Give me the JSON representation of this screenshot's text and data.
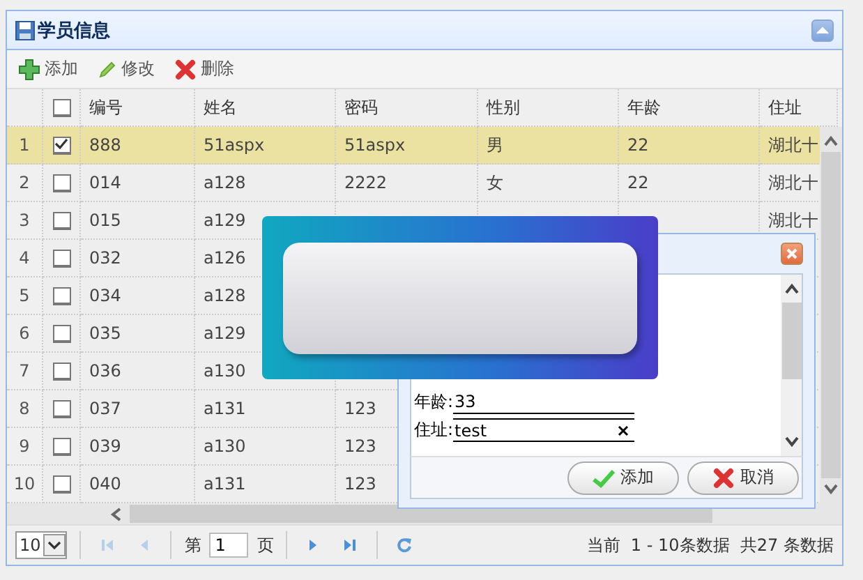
{
  "panel": {
    "title": "学员信息"
  },
  "toolbar": [
    {
      "kind": "add",
      "label": "添加"
    },
    {
      "kind": "edit",
      "label": "修改"
    },
    {
      "kind": "delete",
      "label": "删除"
    }
  ],
  "table": {
    "header_checked": false,
    "columns": [
      "编号",
      "姓名",
      "密码",
      "性别",
      "年龄",
      "住址"
    ],
    "rows": [
      {
        "number": "1",
        "selected": true,
        "checked": true,
        "id": "888",
        "name": "51aspx",
        "password": "51aspx",
        "gender": "男",
        "age": "22",
        "address": "湖北十"
      },
      {
        "number": "2",
        "selected": false,
        "checked": false,
        "id": "014",
        "name": "a128",
        "password": "2222",
        "gender": "女",
        "age": "22",
        "address": "湖北十"
      },
      {
        "number": "3",
        "selected": false,
        "checked": false,
        "id": "015",
        "name": "a129",
        "address": "湖北十"
      },
      {
        "number": "4",
        "selected": false,
        "checked": false,
        "id": "032",
        "name": "a126"
      },
      {
        "number": "5",
        "selected": false,
        "checked": false,
        "id": "034",
        "name": "a128"
      },
      {
        "number": "6",
        "selected": false,
        "checked": false,
        "id": "035",
        "name": "a129"
      },
      {
        "number": "7",
        "selected": false,
        "checked": false,
        "id": "036",
        "name": "a130"
      },
      {
        "number": "8",
        "selected": false,
        "checked": false,
        "id": "037",
        "name": "a131",
        "password": "123"
      },
      {
        "number": "9",
        "selected": false,
        "checked": false,
        "id": "039",
        "name": "a130",
        "password": "123"
      },
      {
        "number": "10",
        "selected": false,
        "checked": false,
        "id": "040",
        "name": "a131",
        "password": "123"
      }
    ]
  },
  "pager": {
    "page_size": "10",
    "page_prefix": "第",
    "page": "1",
    "page_suffix": "页",
    "nav": [
      {
        "kind": "first",
        "disabled": true
      },
      {
        "kind": "prev",
        "disabled": true
      },
      {
        "kind": "next",
        "disabled": false
      },
      {
        "kind": "last",
        "disabled": false
      }
    ],
    "info": "当前  1 - 10条数据  共27 条数据"
  },
  "dialog": {
    "fields": [
      {
        "label": "年龄:",
        "value": "33",
        "clearable": false
      },
      {
        "label": "住址:",
        "value": "test",
        "clearable": true
      }
    ],
    "buttons": [
      {
        "kind": "ok",
        "label": "添加"
      },
      {
        "kind": "cancel",
        "label": "取消"
      }
    ]
  }
}
